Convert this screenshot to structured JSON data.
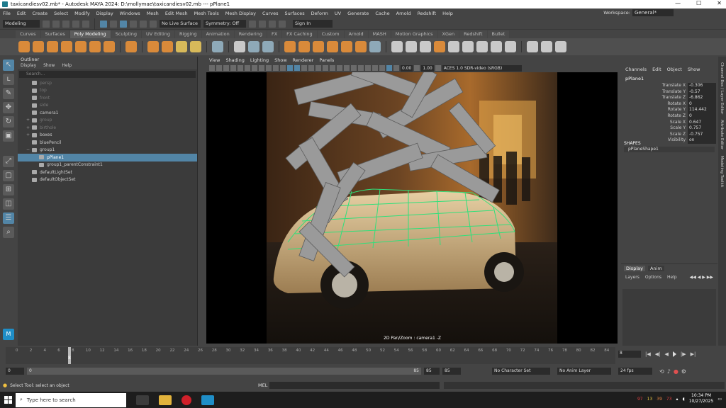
{
  "window": {
    "title": "taxicandiesv02.mb* - Autodesk MAYA 2024: D:\\mollymae\\taxicandiesv02.mb  ---  pPlane1",
    "controls": [
      "—",
      "☐",
      "✕"
    ]
  },
  "menubar": {
    "items": [
      "File",
      "Edit",
      "Create",
      "Select",
      "Modify",
      "Display",
      "Windows",
      "Mesh",
      "Edit Mesh",
      "Mesh Tools",
      "Mesh Display",
      "Curves",
      "Surfaces",
      "Deform",
      "UV",
      "Generate",
      "Cache",
      "Arnold",
      "Redshift",
      "Help"
    ],
    "workspace_label": "Workspace:",
    "workspace_value": "General*"
  },
  "statusline": {
    "mode": "Modeling",
    "live_surface": "No Live Surface",
    "symmetry": "Symmetry: Off",
    "sign_in": "Sign In"
  },
  "shelf_tabs": {
    "items": [
      "Curves",
      "Surfaces",
      "Poly Modeling",
      "Sculpting",
      "UV Editing",
      "Rigging",
      "Animation",
      "Rendering",
      "FX",
      "FX Caching",
      "Custom",
      "Arnold",
      "MASH",
      "Motion Graphics",
      "XGen",
      "Redshift",
      "Bullet"
    ],
    "active": "Poly Modeling"
  },
  "outliner": {
    "title": "Outliner",
    "menu": [
      "Display",
      "Show",
      "Help"
    ],
    "search_placeholder": "Search...",
    "rows": [
      {
        "label": "persp",
        "dim": true,
        "expand": ""
      },
      {
        "label": "top",
        "dim": true,
        "expand": ""
      },
      {
        "label": "front",
        "dim": true,
        "expand": ""
      },
      {
        "label": "side",
        "dim": true,
        "expand": ""
      },
      {
        "label": "camera1",
        "dim": false,
        "expand": ""
      },
      {
        "label": "group",
        "dim": true,
        "expand": "+"
      },
      {
        "label": "birthole",
        "dim": true,
        "expand": "+"
      },
      {
        "label": "boxes",
        "dim": false,
        "expand": "+"
      },
      {
        "label": "bluePencil",
        "dim": false,
        "expand": ""
      },
      {
        "label": "group1",
        "dim": false,
        "expand": "−"
      },
      {
        "label": "pPlane1",
        "dim": false,
        "expand": "",
        "selected": true
      },
      {
        "label": "group1_parentConstraint1",
        "dim": false,
        "expand": ""
      },
      {
        "label": "defaultLightSet",
        "dim": false,
        "expand": ""
      },
      {
        "label": "defaultObjectSet",
        "dim": false,
        "expand": ""
      }
    ]
  },
  "viewport": {
    "menu": [
      "View",
      "Shading",
      "Lighting",
      "Show",
      "Renderer",
      "Panels"
    ],
    "field1": "0.00",
    "field2": "1.00",
    "colorspace": "ACES 1.0 SDR-video (sRGB)",
    "hud": "2D Pan/Zoom : camera1 -Z"
  },
  "channelbox": {
    "menu": [
      "Channels",
      "Edit",
      "Object",
      "Show"
    ],
    "object": "pPlane1",
    "attributes": [
      {
        "name": "Translate X",
        "value": "-0.306"
      },
      {
        "name": "Translate Y",
        "value": "-0.57"
      },
      {
        "name": "Translate Z",
        "value": "-6.862"
      },
      {
        "name": "Rotate X",
        "value": "0"
      },
      {
        "name": "Rotate Y",
        "value": "114.442"
      },
      {
        "name": "Rotate Z",
        "value": "0"
      },
      {
        "name": "Scale X",
        "value": "0.647"
      },
      {
        "name": "Scale Y",
        "value": "0.757"
      },
      {
        "name": "Scale Z",
        "value": "-0.757"
      },
      {
        "name": "Visibility",
        "value": "on"
      }
    ],
    "shapes_label": "SHAPES",
    "shape": "pPlaneShape1"
  },
  "layers": {
    "tabs": [
      "Display",
      "Anim"
    ],
    "active": "Display",
    "menu": [
      "Layers",
      "Options",
      "Help"
    ]
  },
  "sidetabs": [
    "Channel Box / Layer Editor",
    "Attribute Editor",
    "Modeling Toolkit"
  ],
  "timeslider": {
    "ticks": [
      "0",
      "2",
      "4",
      "6",
      "8",
      "10",
      "12",
      "14",
      "16",
      "18",
      "20",
      "22",
      "24",
      "26",
      "28",
      "30",
      "32",
      "34",
      "36",
      "38",
      "40",
      "42",
      "44",
      "46",
      "48",
      "50",
      "52",
      "54",
      "56",
      "58",
      "60",
      "62",
      "64",
      "66",
      "68",
      "70",
      "72",
      "74",
      "76",
      "78",
      "80",
      "82",
      "84"
    ],
    "current_frame": "8",
    "current_field": "8"
  },
  "range": {
    "start": "0",
    "inner_start": "0",
    "inner_end": "85",
    "end_a": "85",
    "end_b": "85",
    "character_set": "No Character Set",
    "anim_layer": "No Anim Layer",
    "fps": "24 fps"
  },
  "helpline": {
    "text": "Select Tool: select an object",
    "mel": "MEL"
  },
  "taskbar": {
    "search_placeholder": "Type here to search",
    "time": "10:34 PM",
    "date": "10/27/2025",
    "tray_numbers": [
      "97",
      "13",
      "39",
      "73"
    ]
  }
}
